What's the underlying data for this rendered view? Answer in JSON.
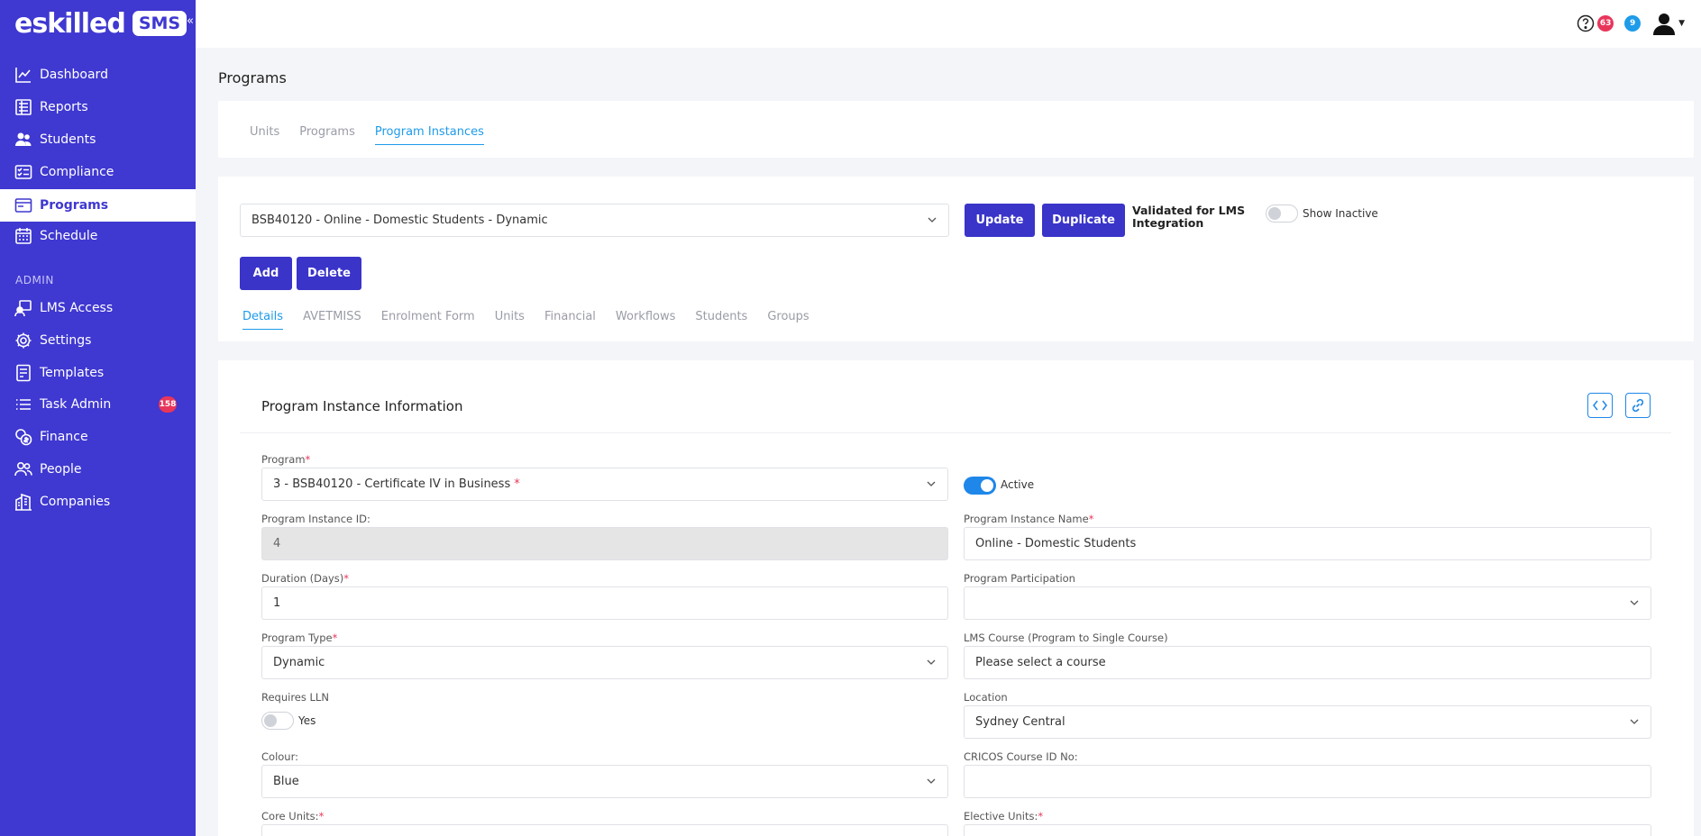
{
  "app": {
    "logo_word": "eskilled",
    "logo_badge": "SMS"
  },
  "sidebar": {
    "items": [
      {
        "label": "Dashboard",
        "icon": "chart-line-icon"
      },
      {
        "label": "Reports",
        "icon": "report-icon"
      },
      {
        "label": "Students",
        "icon": "users-icon"
      },
      {
        "label": "Compliance",
        "icon": "checklist-icon"
      },
      {
        "label": "Programs",
        "icon": "programs-icon",
        "active": true
      },
      {
        "label": "Schedule",
        "icon": "calendar-icon"
      }
    ],
    "admin_label": "ADMIN",
    "admin_items": [
      {
        "label": "LMS Access",
        "icon": "lms-access-icon"
      },
      {
        "label": "Settings",
        "icon": "gear-icon"
      },
      {
        "label": "Templates",
        "icon": "template-icon"
      },
      {
        "label": "Task Admin",
        "icon": "task-list-icon",
        "badge": "158"
      },
      {
        "label": "Finance",
        "icon": "coins-icon"
      },
      {
        "label": "People",
        "icon": "people-icon"
      },
      {
        "label": "Companies",
        "icon": "building-icon"
      }
    ]
  },
  "topbar": {
    "notif_count": "63",
    "message_count": "9"
  },
  "page": {
    "title": "Programs"
  },
  "main_tabs": [
    "Units",
    "Programs",
    "Program Instances"
  ],
  "instance_bar": {
    "selected_instance": "BSB40120 - Online - Domestic Students - Dynamic",
    "update_label": "Update",
    "duplicate_label": "Duplicate",
    "validated_text": "Validated for LMS Integration",
    "show_inactive_label": "Show Inactive",
    "add_label": "Add",
    "delete_label": "Delete"
  },
  "sub_tabs": [
    "Details",
    "AVETMISS",
    "Enrolment Form",
    "Units",
    "Financial",
    "Workflows",
    "Students",
    "Groups"
  ],
  "form": {
    "section_title": "Program Instance Information",
    "program_label": "Program",
    "program_value": "3 - BSB40120 - Certificate IV in Business",
    "active_label": "Active",
    "instance_id_label": "Program Instance ID:",
    "instance_id_value": "4",
    "instance_name_label": "Program Instance Name",
    "instance_name_value": "Online - Domestic Students",
    "duration_label": "Duration (Days)",
    "duration_value": "1",
    "participation_label": "Program Participation",
    "participation_value": "",
    "type_label": "Program Type",
    "type_value": "Dynamic",
    "lms_course_label": "LMS Course (Program to Single Course)",
    "lms_course_value": "Please select a course",
    "lln_label": "Requires LLN",
    "lln_toggle_label": "Yes",
    "location_label": "Location",
    "location_value": "Sydney Central",
    "colour_label": "Colour:",
    "colour_value": "Blue",
    "cricos_label": "CRICOS Course ID No:",
    "cricos_value": "",
    "core_units_label": "Core Units:",
    "elective_units_label": "Elective Units:"
  },
  "colors": {
    "sidebar": "#3f38d1",
    "button": "#3a34c9",
    "accent": "#1e87e9",
    "badge": "#e8365a"
  }
}
